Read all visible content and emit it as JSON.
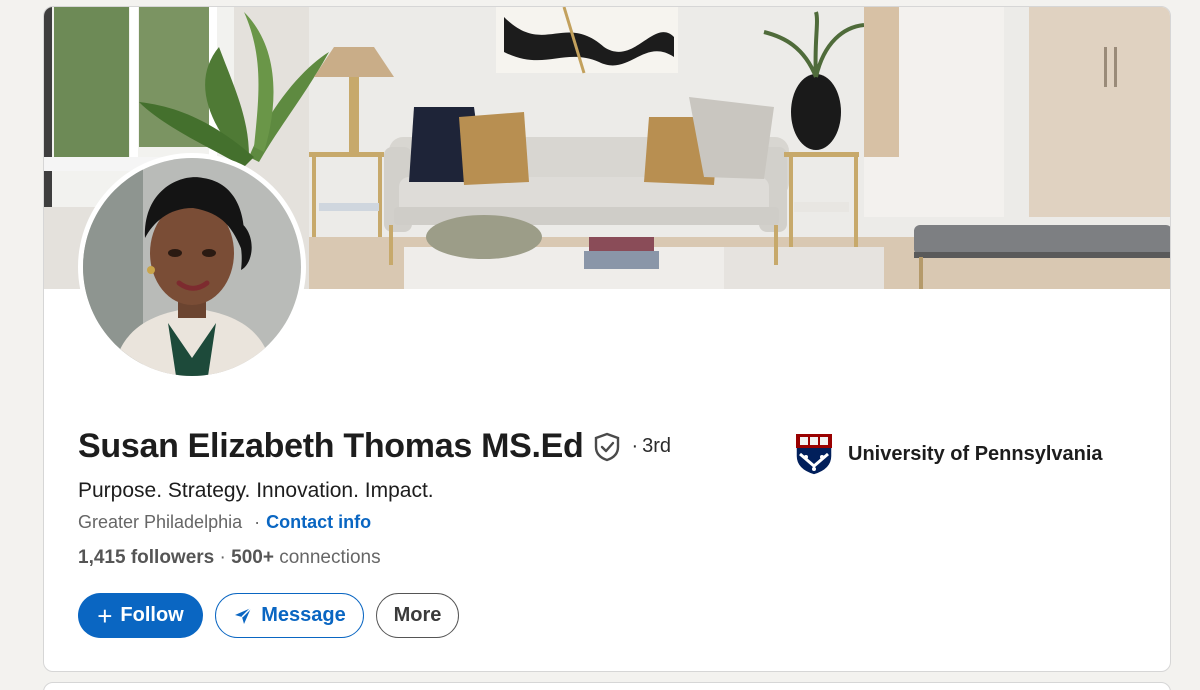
{
  "profile": {
    "name": "Susan Elizabeth Thomas MS.Ed",
    "degree_prefix": "·",
    "degree": "3rd",
    "headline": "Purpose. Strategy. Innovation. Impact.",
    "location": "Greater Philadelphia",
    "separator": "·",
    "contact_label": "Contact info",
    "followers_count": "1,415",
    "followers_label": "followers",
    "stats_separator": "·",
    "connections_count": "500+",
    "connections_label": "connections"
  },
  "actions": {
    "follow_icon": "+",
    "follow_label": "Follow",
    "message_label": "Message",
    "more_label": "More"
  },
  "education": {
    "school_name": "University of Pennsylvania",
    "logo": "penn-shield-icon"
  },
  "icons": {
    "verified": "shield-check-icon",
    "message": "paper-plane-icon"
  },
  "colors": {
    "accent": "#0a66c2",
    "background": "#f3f2ef",
    "card": "#ffffff",
    "penn_red": "#990000",
    "penn_blue": "#011f5b"
  }
}
